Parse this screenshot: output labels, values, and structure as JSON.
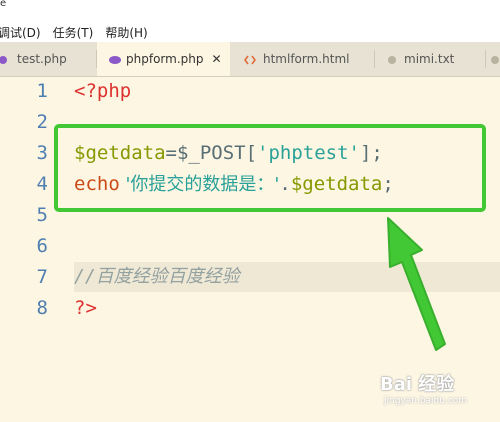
{
  "menubar": {
    "top_fragment": "e",
    "items": [
      "调试(D)",
      "任务(T)",
      "帮助(H)"
    ]
  },
  "tabs": [
    {
      "label": "test.php",
      "icon": "php-icon"
    },
    {
      "label": "phpform.php",
      "icon": "php-icon",
      "active": true,
      "close": "✕"
    },
    {
      "label": "htmlform.html",
      "icon": "html-icon"
    },
    {
      "label": "mimi.txt",
      "icon": "txt-icon"
    }
  ],
  "editor": {
    "line_numbers": [
      "1",
      "2",
      "3",
      "4",
      "5",
      "6",
      "7",
      "8"
    ],
    "line1": "<?php",
    "line3": {
      "var": "$getdata",
      "eq": "=$_POST[",
      "str": "'phptest'",
      "end": "];"
    },
    "line4": {
      "kw": "echo",
      "str": " '你提交的数据是：'",
      "dot": ".",
      "var": "$getdata",
      "end": ";"
    },
    "line7": "//百度经验百度经验",
    "line8": "?>"
  },
  "colors": {
    "background": "#fdf6e3",
    "highlight": "#41c834",
    "arrow": "#41c834"
  },
  "watermark": {
    "main": "Bai 经验",
    "sub": "jingyan.baidu.com"
  }
}
